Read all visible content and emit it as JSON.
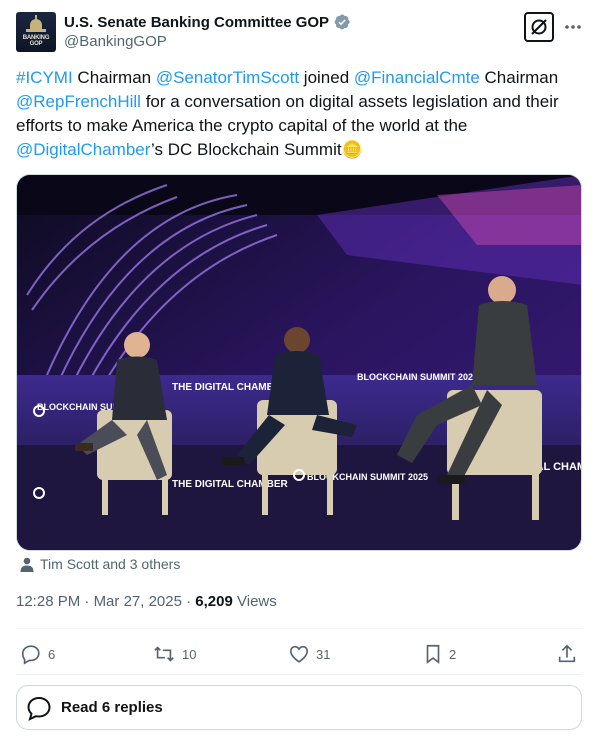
{
  "account": {
    "display_name": "U.S. Senate Banking Committee GOP",
    "handle": "@BankingGOP",
    "avatar_text": "BANKING GOP",
    "verified": true
  },
  "tweet": {
    "segments": [
      {
        "text": "#ICYMI",
        "link": true
      },
      {
        "text": " Chairman ",
        "link": false
      },
      {
        "text": "@SenatorTimScott",
        "link": true
      },
      {
        "text": " joined ",
        "link": false
      },
      {
        "text": "@FinancialCmte",
        "link": true
      },
      {
        "text": " Chairman ",
        "link": false
      },
      {
        "text": "@RepFrenchHill",
        "link": true
      },
      {
        "text": " for a conversation on digital assets legislation and their efforts to make America the crypto capital of the world at the ",
        "link": false
      },
      {
        "text": "@DigitalChamber",
        "link": true
      },
      {
        "text": "’s DC Blockchain Summit",
        "link": false
      },
      {
        "text": "🪙",
        "link": false
      }
    ]
  },
  "media": {
    "stage_text": {
      "brand_left": "THE DIGITAL CHAMBER",
      "brand_right": "THE DIGITAL CHAMBER",
      "summit_top": "BLOCKCHAIN SUMMIT 2025",
      "summit_left": "BLOCKCHAIN SUMMIT 2025",
      "summit_bottom": "BLOCKCHAIN SUMMIT 2025",
      "brand_bottom": "THE DIGITAL CHAMBER"
    }
  },
  "tagged": "Tim Scott and 3 others",
  "meta": {
    "time": "12:28 PM",
    "separator": " · ",
    "date": "Mar 27, 2025",
    "views_count": "6,209",
    "views_label": " Views"
  },
  "actions": {
    "replies": "6",
    "reposts": "10",
    "likes": "31",
    "bookmarks": "2"
  },
  "read_replies": "Read 6 replies",
  "colors": {
    "link": "#1d9bf0",
    "muted": "#536471",
    "text": "#0f1419"
  },
  "icons": [
    "verified-badge-icon",
    "grok-icon",
    "more-icon",
    "person-icon",
    "reply-icon",
    "repost-icon",
    "like-icon",
    "bookmark-icon",
    "share-icon",
    "speech-bubble-icon"
  ]
}
